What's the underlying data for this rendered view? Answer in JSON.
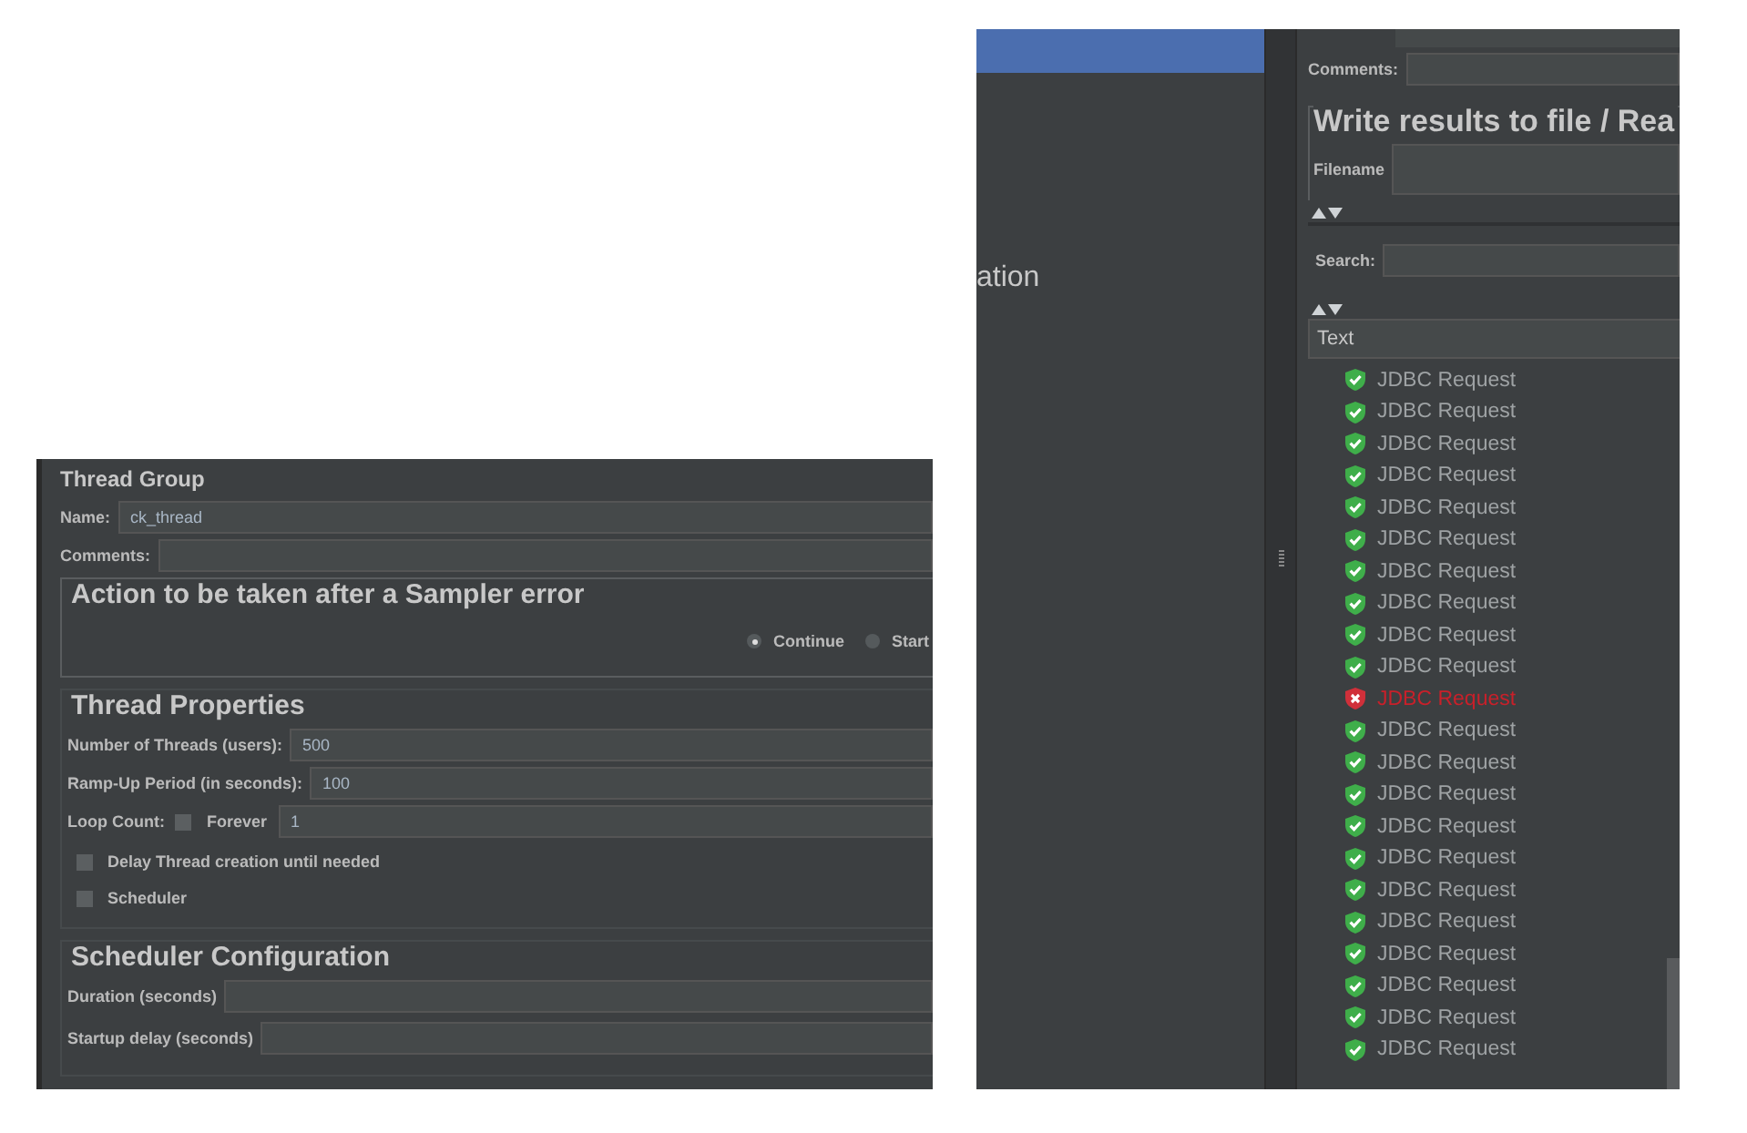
{
  "thread_group": {
    "title": "Thread Group",
    "name": {
      "label": "Name:",
      "value": "ck_thread"
    },
    "comments": {
      "label": "Comments:"
    },
    "sampler_error": {
      "title": "Action to be taken after a Sampler error",
      "options": [
        {
          "label": "Continue",
          "selected": true
        },
        {
          "label": "Start",
          "selected": false
        }
      ]
    },
    "thread_properties": {
      "title": "Thread Properties",
      "threads": {
        "label": "Number of Threads (users):",
        "value": "500"
      },
      "ramp_up": {
        "label": "Ramp-Up Period (in seconds):",
        "value": "100"
      },
      "loop_count": {
        "label": "Loop Count:",
        "forever": {
          "label": "Forever",
          "checked": false
        },
        "value": "1"
      },
      "checkboxes": [
        {
          "label": "Delay Thread creation until needed",
          "checked": false
        },
        {
          "label": "Scheduler",
          "checked": false
        }
      ]
    },
    "scheduler": {
      "title": "Scheduler Configuration",
      "fields": [
        {
          "label": "Duration (seconds)"
        },
        {
          "label": "Startup delay (seconds)"
        }
      ]
    }
  },
  "results_tree": {
    "sidebar": {
      "item": "ation"
    },
    "comments": {
      "label": "Comments:"
    },
    "write_results": {
      "title": "Write results to file / Rea",
      "filename_label": "Filename"
    },
    "search": {
      "label": "Search:"
    },
    "renderer": {
      "value": "Text"
    },
    "results": [
      {
        "label": "JDBC Request",
        "failed": false
      },
      {
        "label": "JDBC Request",
        "failed": false
      },
      {
        "label": "JDBC Request",
        "failed": false
      },
      {
        "label": "JDBC Request",
        "failed": false
      },
      {
        "label": "JDBC Request",
        "failed": false
      },
      {
        "label": "JDBC Request",
        "failed": false
      },
      {
        "label": "JDBC Request",
        "failed": false
      },
      {
        "label": "JDBC Request",
        "failed": false
      },
      {
        "label": "JDBC Request",
        "failed": false
      },
      {
        "label": "JDBC Request",
        "failed": false
      },
      {
        "label": "JDBC Request",
        "failed": true
      },
      {
        "label": "JDBC Request",
        "failed": false
      },
      {
        "label": "JDBC Request",
        "failed": false
      },
      {
        "label": "JDBC Request",
        "failed": false
      },
      {
        "label": "JDBC Request",
        "failed": false
      },
      {
        "label": "JDBC Request",
        "failed": false
      },
      {
        "label": "JDBC Request",
        "failed": false
      },
      {
        "label": "JDBC Request",
        "failed": false
      },
      {
        "label": "JDBC Request",
        "failed": false
      },
      {
        "label": "JDBC Request",
        "failed": false
      },
      {
        "label": "JDBC Request",
        "failed": false
      },
      {
        "label": "JDBC Request",
        "failed": false
      }
    ]
  }
}
